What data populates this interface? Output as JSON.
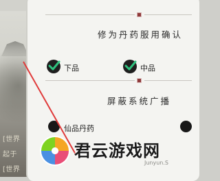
{
  "section1": {
    "title": "修为丹药服用确认"
  },
  "options1": [
    {
      "label": "下品",
      "checked": true
    },
    {
      "label": "中品",
      "checked": true
    }
  ],
  "section2": {
    "title": "屏蔽系统广播"
  },
  "options2": [
    {
      "label": "仙品丹药"
    }
  ],
  "chat": [
    "[世界",
    "起于",
    "[世界"
  ],
  "watermark": {
    "brand": "君云游戏网",
    "small": "Junyun.S",
    "accent": "#e03a3a"
  },
  "colors": {
    "panel": "#f4f4f1",
    "diamond": "#8f3a3a",
    "check_bg": "#1f1f1f",
    "check_mark": "#2ec27e"
  }
}
